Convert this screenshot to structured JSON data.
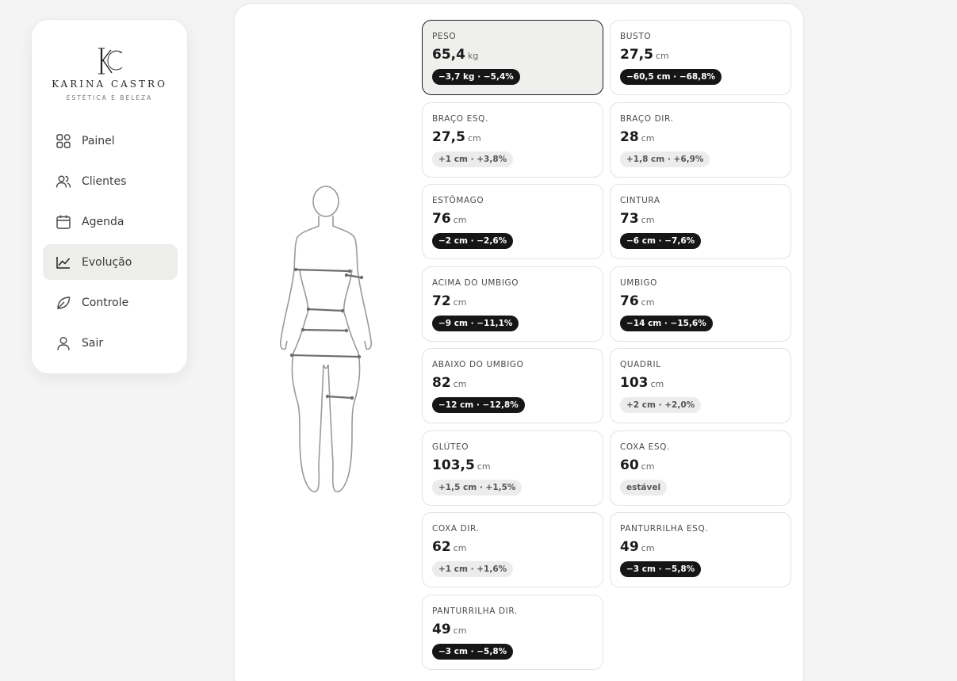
{
  "brand": {
    "monogram": "KC",
    "name": "KARINA CASTRO",
    "subtitle": "ESTÉTICA E BELEZA"
  },
  "nav": [
    {
      "label": "Painel",
      "icon": "grid-icon",
      "active": false
    },
    {
      "label": "Clientes",
      "icon": "users-icon",
      "active": false
    },
    {
      "label": "Agenda",
      "icon": "calendar-icon",
      "active": false
    },
    {
      "label": "Evolução",
      "icon": "trend-icon",
      "active": true
    },
    {
      "label": "Controle",
      "icon": "leaf-icon",
      "active": false
    },
    {
      "label": "Sair",
      "icon": "user-icon",
      "active": false
    }
  ],
  "measurements": [
    {
      "label": "PESO",
      "value": "65,4",
      "unit": "kg",
      "delta": "−3,7 kg · −5,4%",
      "tone": "dark",
      "active": true
    },
    {
      "label": "BUSTO",
      "value": "27,5",
      "unit": "cm",
      "delta": "−60,5 cm · −68,8%",
      "tone": "dark",
      "active": false
    },
    {
      "label": "BRAÇO ESQ.",
      "value": "27,5",
      "unit": "cm",
      "delta": "+1 cm · +3,8%",
      "tone": "light",
      "active": false
    },
    {
      "label": "BRAÇO DIR.",
      "value": "28",
      "unit": "cm",
      "delta": "+1,8 cm · +6,9%",
      "tone": "light",
      "active": false
    },
    {
      "label": "ESTÔMAGO",
      "value": "76",
      "unit": "cm",
      "delta": "−2 cm · −2,6%",
      "tone": "dark",
      "active": false
    },
    {
      "label": "CINTURA",
      "value": "73",
      "unit": "cm",
      "delta": "−6 cm · −7,6%",
      "tone": "dark",
      "active": false
    },
    {
      "label": "ACIMA DO UMBIGO",
      "value": "72",
      "unit": "cm",
      "delta": "−9 cm · −11,1%",
      "tone": "dark",
      "active": false
    },
    {
      "label": "UMBIGO",
      "value": "76",
      "unit": "cm",
      "delta": "−14 cm · −15,6%",
      "tone": "dark",
      "active": false
    },
    {
      "label": "ABAIXO DO UMBIGO",
      "value": "82",
      "unit": "cm",
      "delta": "−12 cm · −12,8%",
      "tone": "dark",
      "active": false
    },
    {
      "label": "QUADRIL",
      "value": "103",
      "unit": "cm",
      "delta": "+2 cm · +2,0%",
      "tone": "light",
      "active": false
    },
    {
      "label": "GLÚTEO",
      "value": "103,5",
      "unit": "cm",
      "delta": "+1,5 cm · +1,5%",
      "tone": "light",
      "active": false
    },
    {
      "label": "COXA ESQ.",
      "value": "60",
      "unit": "cm",
      "delta": "estável",
      "tone": "light",
      "active": false
    },
    {
      "label": "COXA DIR.",
      "value": "62",
      "unit": "cm",
      "delta": "+1 cm · +1,6%",
      "tone": "light",
      "active": false
    },
    {
      "label": "PANTURRILHA ESQ.",
      "value": "49",
      "unit": "cm",
      "delta": "−3 cm · −5,8%",
      "tone": "dark",
      "active": false
    },
    {
      "label": "PANTURRILHA DIR.",
      "value": "49",
      "unit": "cm",
      "delta": "−3 cm · −5,8%",
      "tone": "dark",
      "active": false
    }
  ],
  "colors": {
    "accent_dark": "#161616",
    "badge_light": "#ececec",
    "active_nav": "#ededeb",
    "background": "#f4f4f4"
  }
}
